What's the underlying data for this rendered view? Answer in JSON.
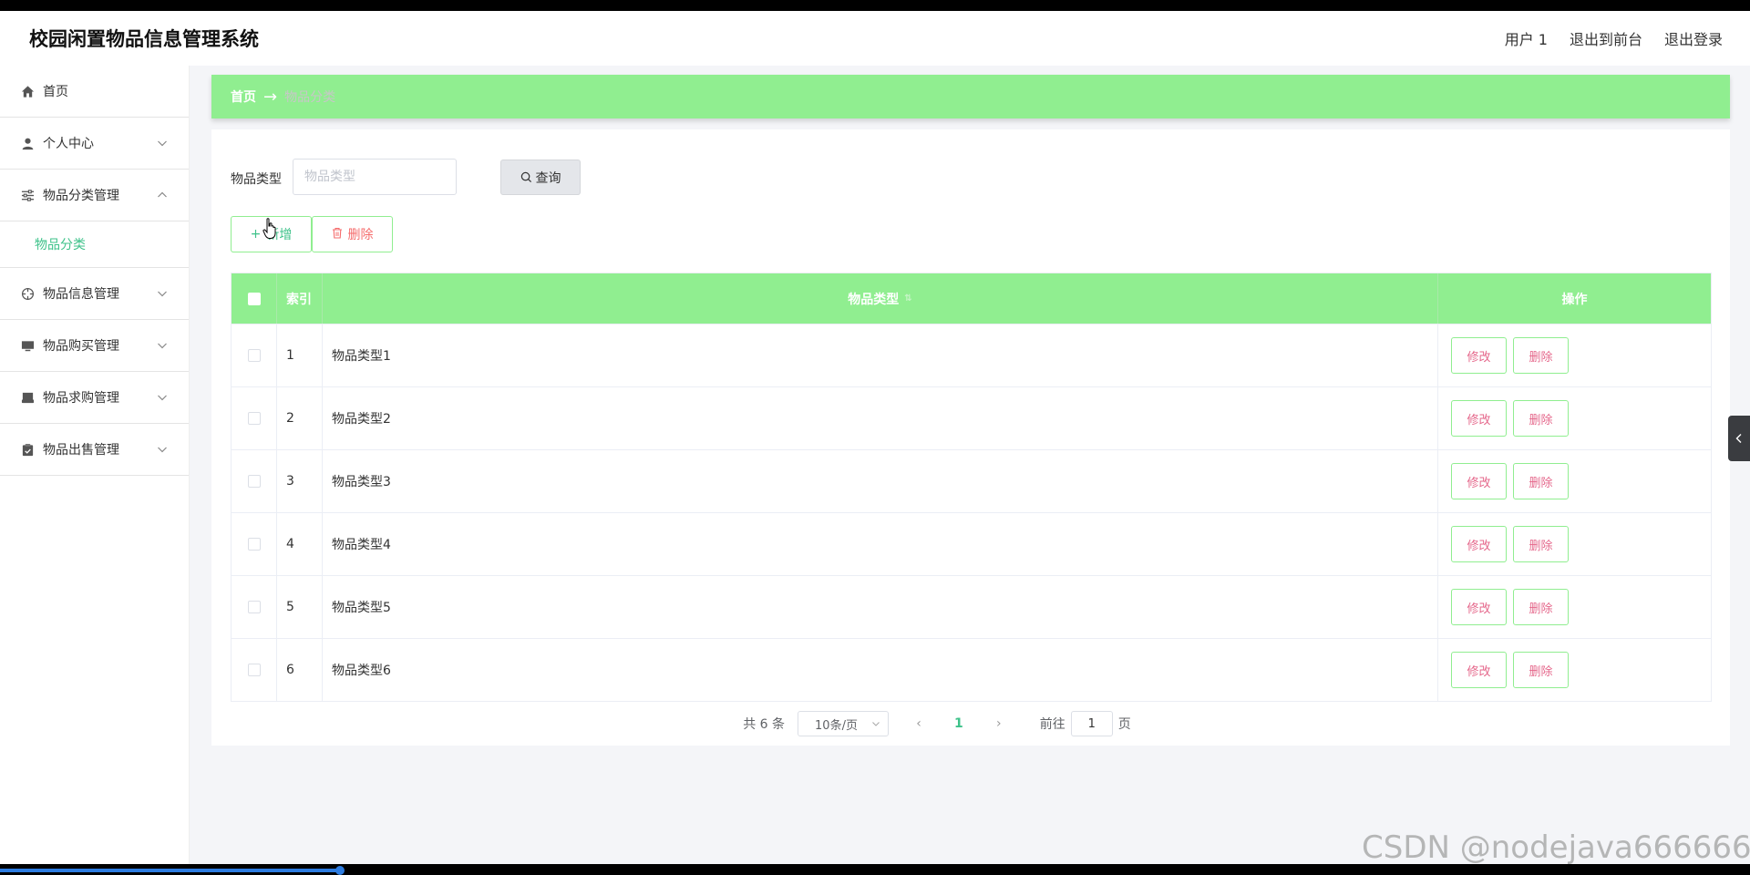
{
  "app": {
    "title": "校园闲置物品信息管理系统"
  },
  "header": {
    "user": "用户 1",
    "to_front": "退出到前台",
    "logout": "退出登录"
  },
  "sidebar": {
    "items": [
      {
        "label": "首页",
        "icon": "home-icon"
      },
      {
        "label": "个人中心",
        "icon": "user-icon"
      },
      {
        "label": "物品分类管理",
        "icon": "sliders-icon",
        "expanded": true
      },
      {
        "label": "物品信息管理",
        "icon": "crosshair-icon"
      },
      {
        "label": "物品购买管理",
        "icon": "monitor-icon"
      },
      {
        "label": "物品求购管理",
        "icon": "printer-icon"
      },
      {
        "label": "物品出售管理",
        "icon": "clipboard-icon"
      }
    ],
    "sub_active": "物品分类"
  },
  "breadcrumb": {
    "home": "首页",
    "separator": "→",
    "current": "物品分类"
  },
  "search": {
    "label": "物品类型",
    "placeholder": "物品类型",
    "button": "查询"
  },
  "actions": {
    "add": "新增",
    "delete": "删除"
  },
  "table": {
    "headers": {
      "index": "索引",
      "type": "物品类型",
      "ops": "操作"
    },
    "rows": [
      {
        "index": "1",
        "type": "物品类型1"
      },
      {
        "index": "2",
        "type": "物品类型2"
      },
      {
        "index": "3",
        "type": "物品类型3"
      },
      {
        "index": "4",
        "type": "物品类型4"
      },
      {
        "index": "5",
        "type": "物品类型5"
      },
      {
        "index": "6",
        "type": "物品类型6"
      }
    ],
    "row_ops": {
      "edit": "修改",
      "delete": "删除"
    }
  },
  "pagination": {
    "total": "共 6 条",
    "page_size": "10条/页",
    "current_page": "1",
    "goto_label": "前往",
    "goto_value": "1",
    "goto_suffix": "页"
  },
  "watermark": "CSDN @nodejava666666",
  "colors": {
    "accent_green": "#90ee90",
    "active_text": "#3ec28a",
    "danger": "#f56c6c"
  }
}
